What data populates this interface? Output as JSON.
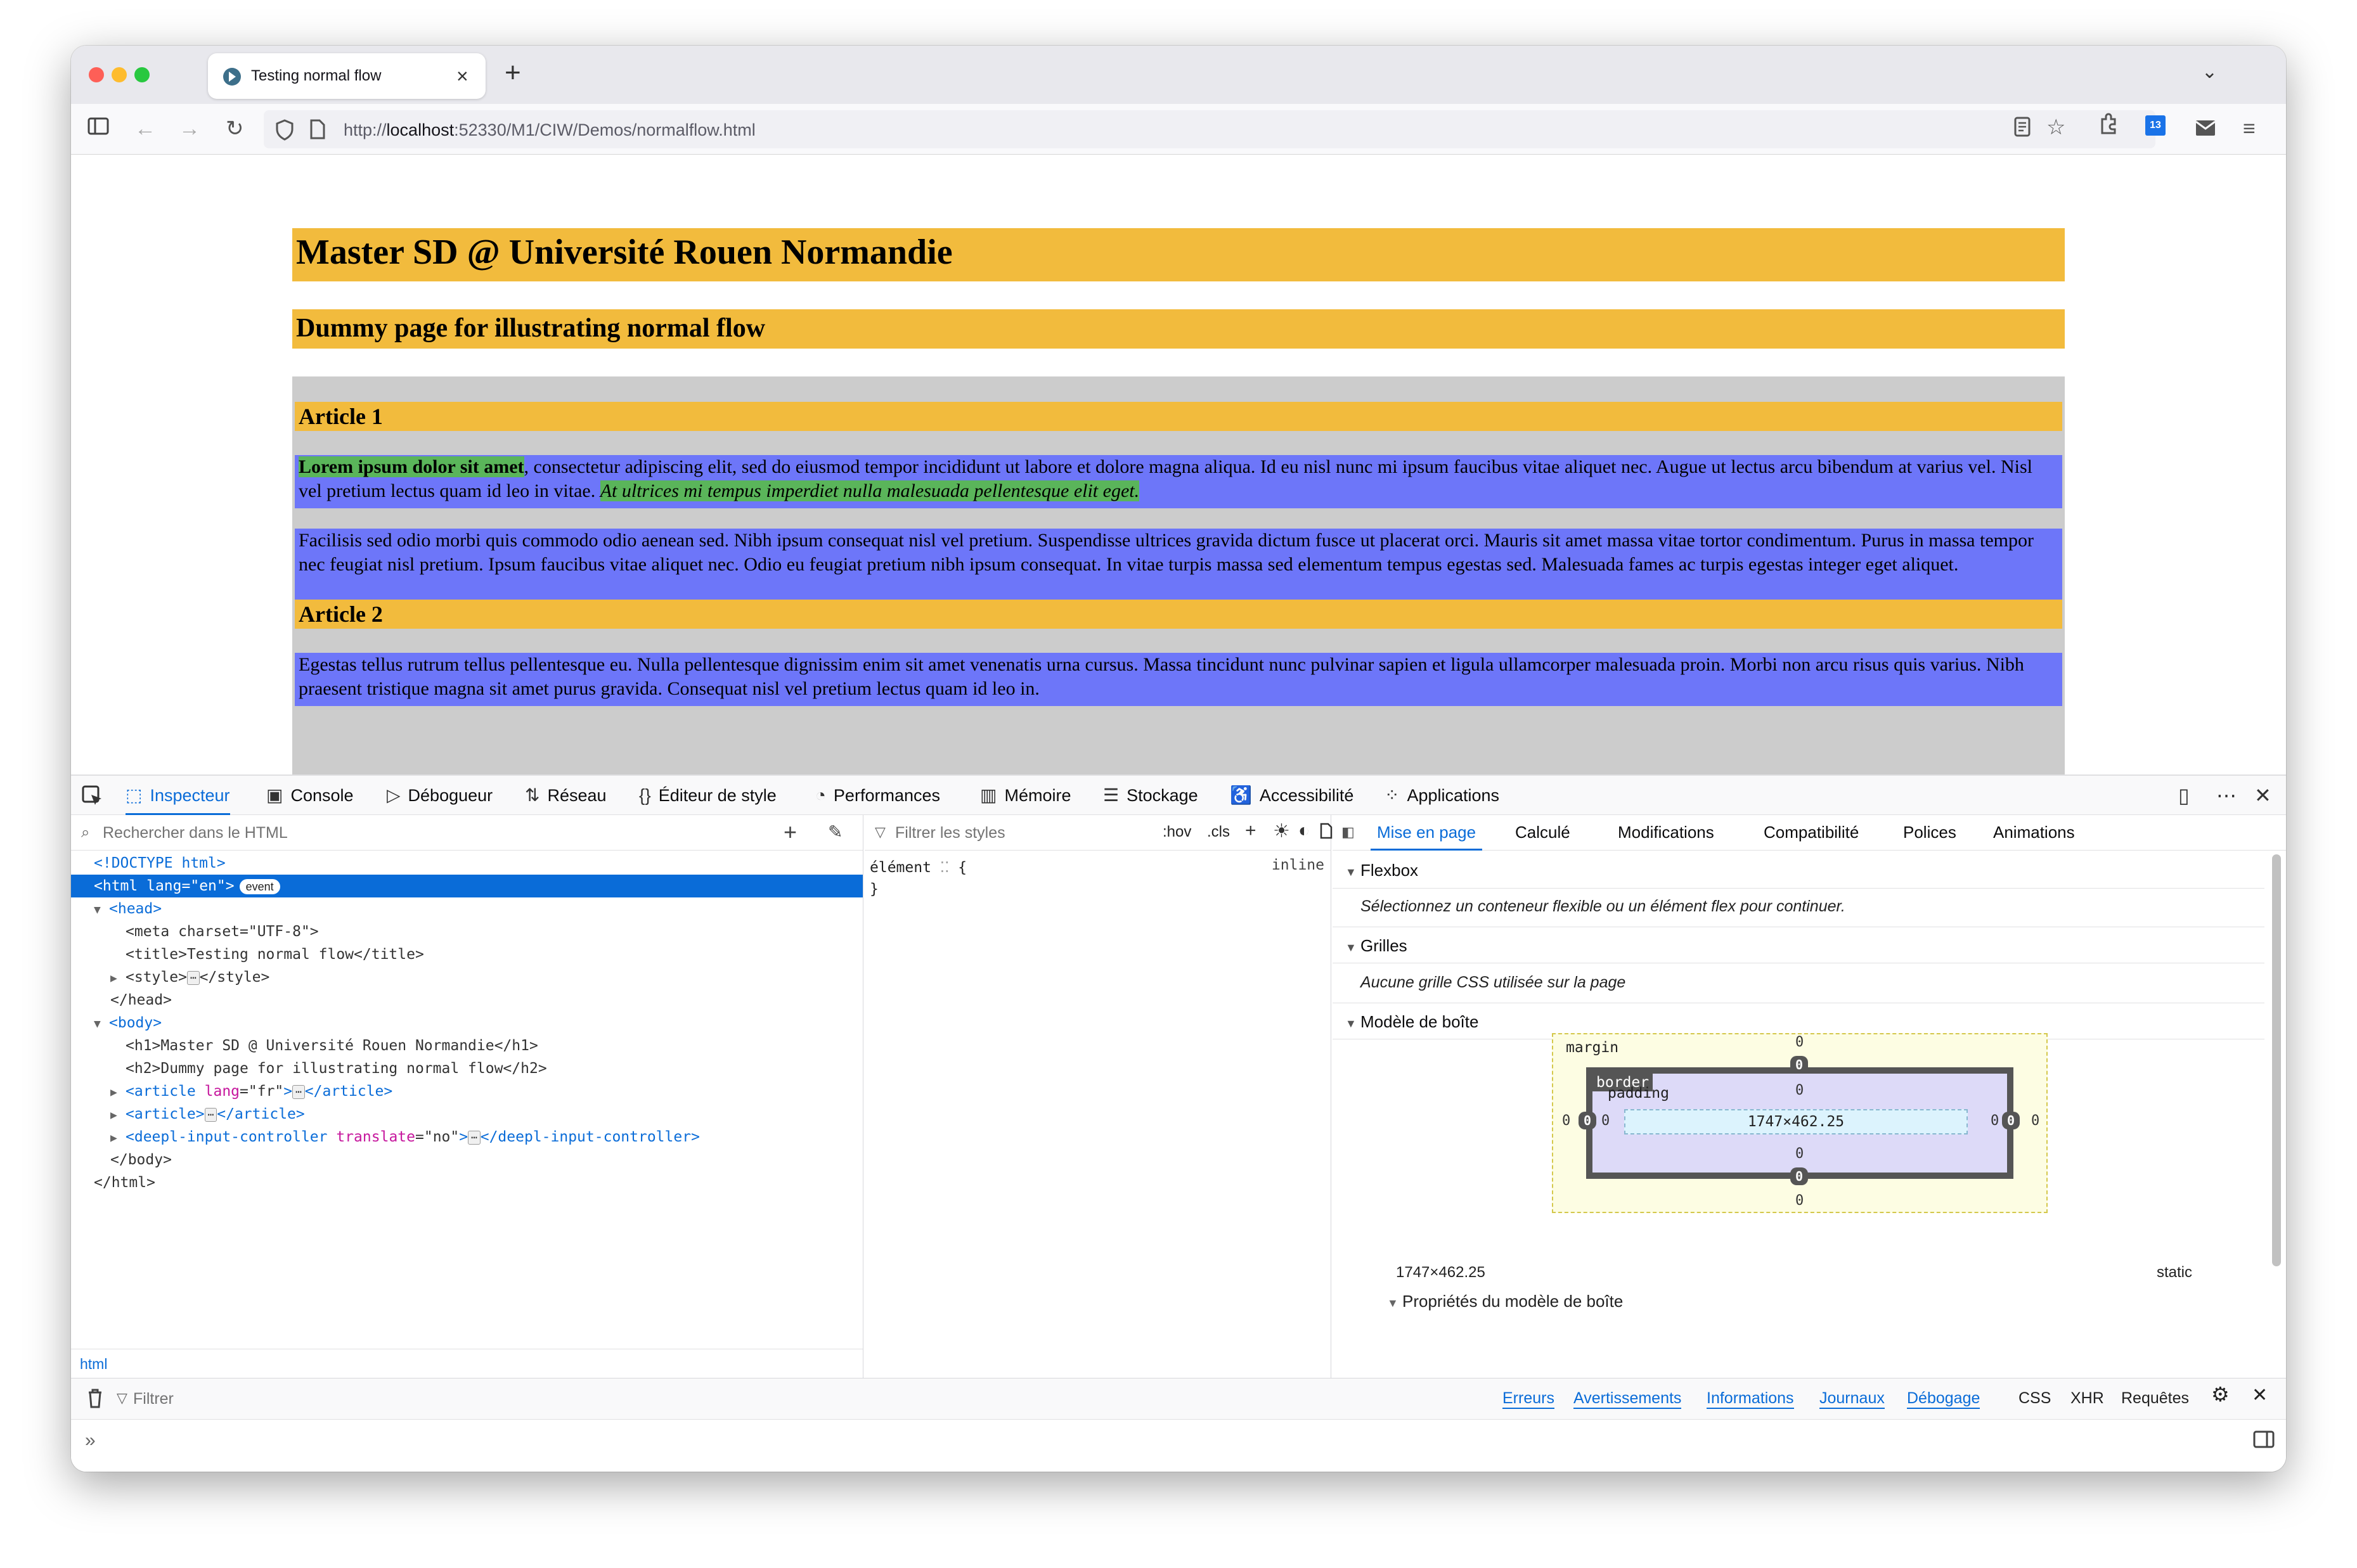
{
  "browser": {
    "tab_title": "Testing normal flow",
    "tab_close": "×",
    "new_tab": "+",
    "tab_list_chevron": "⌄",
    "url_prefix": "http://",
    "url_host": "localhost",
    "url_rest": ":52330/M1/CIW/Demos/normalflow.html",
    "nav_icons": [
      "sidebar-icon",
      "back-icon",
      "forward-icon",
      "reload-icon",
      "shield-icon",
      "page-icon",
      "reader-icon",
      "bookmark-star-icon",
      "extensions-icon",
      "calendar-icon",
      "mail-icon",
      "menu-icon"
    ],
    "calendar_badge": "13"
  },
  "page": {
    "h1": "Master SD @ Université Rouen Normandie",
    "h2": "Dummy page for illustrating normal flow",
    "article1": {
      "title": "Article 1",
      "p1_strong": "Lorem ipsum dolor sit amet",
      "p1_text": ", consectetur adipiscing elit, sed do eiusmod tempor incididunt ut labore et dolore magna aliqua. Id eu nisl nunc mi ipsum faucibus vitae aliquet nec. Augue ut lectus arcu bibendum at varius vel. Nisl vel pretium lectus quam id leo in vitae. ",
      "p1_em": "At ultrices mi tempus imperdiet nulla malesuada pellentesque elit eget.",
      "p2": "Facilisis sed odio morbi quis commodo odio aenean sed. Nibh ipsum consequat nisl vel pretium. Suspendisse ultrices gravida dictum fusce ut placerat orci. Mauris sit amet massa vitae tortor condimentum. Purus in massa tempor nec feugiat nisl pretium. Ipsum faucibus vitae aliquet nec. Odio eu feugiat pretium nibh ipsum consequat. In vitae turpis massa sed elementum tempus egestas sed. Malesuada fames ac turpis egestas integer eget aliquet."
    },
    "article2": {
      "title": "Article 2",
      "p1": "Egestas tellus rutrum tellus pellentesque eu. Nulla pellentesque dignissim enim sit amet venenatis urna cursus. Massa tincidunt nunc pulvinar sapien et ligula ullamcorper malesuada proin. Morbi non arcu risus quis varius. Nibh praesent tristique magna sit amet purus gravida. Consequat nisl vel pretium lectus quam id leo in."
    },
    "colors": {
      "heading_bg": "#f2bb3d",
      "article_bg": "#cccccc",
      "para_bg": "#6d76f9",
      "highlight": "#5ab55a"
    }
  },
  "devtools": {
    "tabs": [
      {
        "label": "Inspecteur",
        "icon": "inspector-icon"
      },
      {
        "label": "Console",
        "icon": "console-icon"
      },
      {
        "label": "Débogueur",
        "icon": "debugger-icon"
      },
      {
        "label": "Réseau",
        "icon": "network-icon"
      },
      {
        "label": "Éditeur de style",
        "icon": "style-editor-icon"
      },
      {
        "label": "Performances",
        "icon": "performance-icon"
      },
      {
        "label": "Mémoire",
        "icon": "memory-icon"
      },
      {
        "label": "Stockage",
        "icon": "storage-icon"
      },
      {
        "label": "Accessibilité",
        "icon": "accessibility-icon"
      },
      {
        "label": "Applications",
        "icon": "applications-icon"
      }
    ],
    "html_search_placeholder": "Rechercher dans le HTML",
    "tree": {
      "doctype": "<!DOCTYPE html>",
      "html_open": "<html",
      "html_attr": "lang",
      "html_val": "\"en\"",
      "event_badge": "event",
      "head_open": "<head>",
      "meta": "<meta charset=\"UTF-8\">",
      "title": "<title>Testing normal flow</title>",
      "style_open": "<style>",
      "style_close": "</style>",
      "head_close": "</head>",
      "body_open": "<body>",
      "h1": "<h1>Master SD @ Université Rouen Normandie</h1>",
      "h2": "<h2>Dummy page for illustrating normal flow</h2>",
      "article_open": "<article",
      "article_attr": "lang",
      "article_val": "\"fr\"",
      "article_close": "</article>",
      "article2_open": "<article>",
      "deepl_open": "<deepl-input-controller",
      "deepl_attr": "translate",
      "deepl_val": "\"no\"",
      "deepl_close": "</deepl-input-controller>",
      "body_close": "</body>",
      "html_close": "</html>",
      "ellipsis": "⋯"
    },
    "breadcrumb": "html",
    "rules": {
      "filter_placeholder": "Filtrer les styles",
      "hov": ":hov",
      "cls": ".cls",
      "selector": "élément",
      "brace_open": "{",
      "brace_close": "}",
      "source": "inline"
    },
    "layout": {
      "tabs": [
        "Mise en page",
        "Calculé",
        "Modifications",
        "Compatibilité",
        "Polices",
        "Animations"
      ],
      "flexbox_title": "Flexbox",
      "flexbox_msg": "Sélectionnez un conteneur flexible ou un élément flex pour continuer.",
      "grids_title": "Grilles",
      "grids_msg": "Aucune grille CSS utilisée sur la page",
      "boxmodel_title": "Modèle de boîte",
      "margin_label": "margin",
      "border_label": "border",
      "padding_label": "padding",
      "content_dims": "1747×462.25",
      "zero": "0",
      "dims": "1747×462.25",
      "position": "static",
      "props_title": "Propriétés du modèle de boîte"
    },
    "console": {
      "filter_placeholder": "Filtrer",
      "filters": [
        "Erreurs",
        "Avertissements",
        "Informations",
        "Journaux",
        "Débogage"
      ],
      "extra": [
        "CSS",
        "XHR",
        "Requêtes"
      ],
      "prompt": "»"
    }
  }
}
